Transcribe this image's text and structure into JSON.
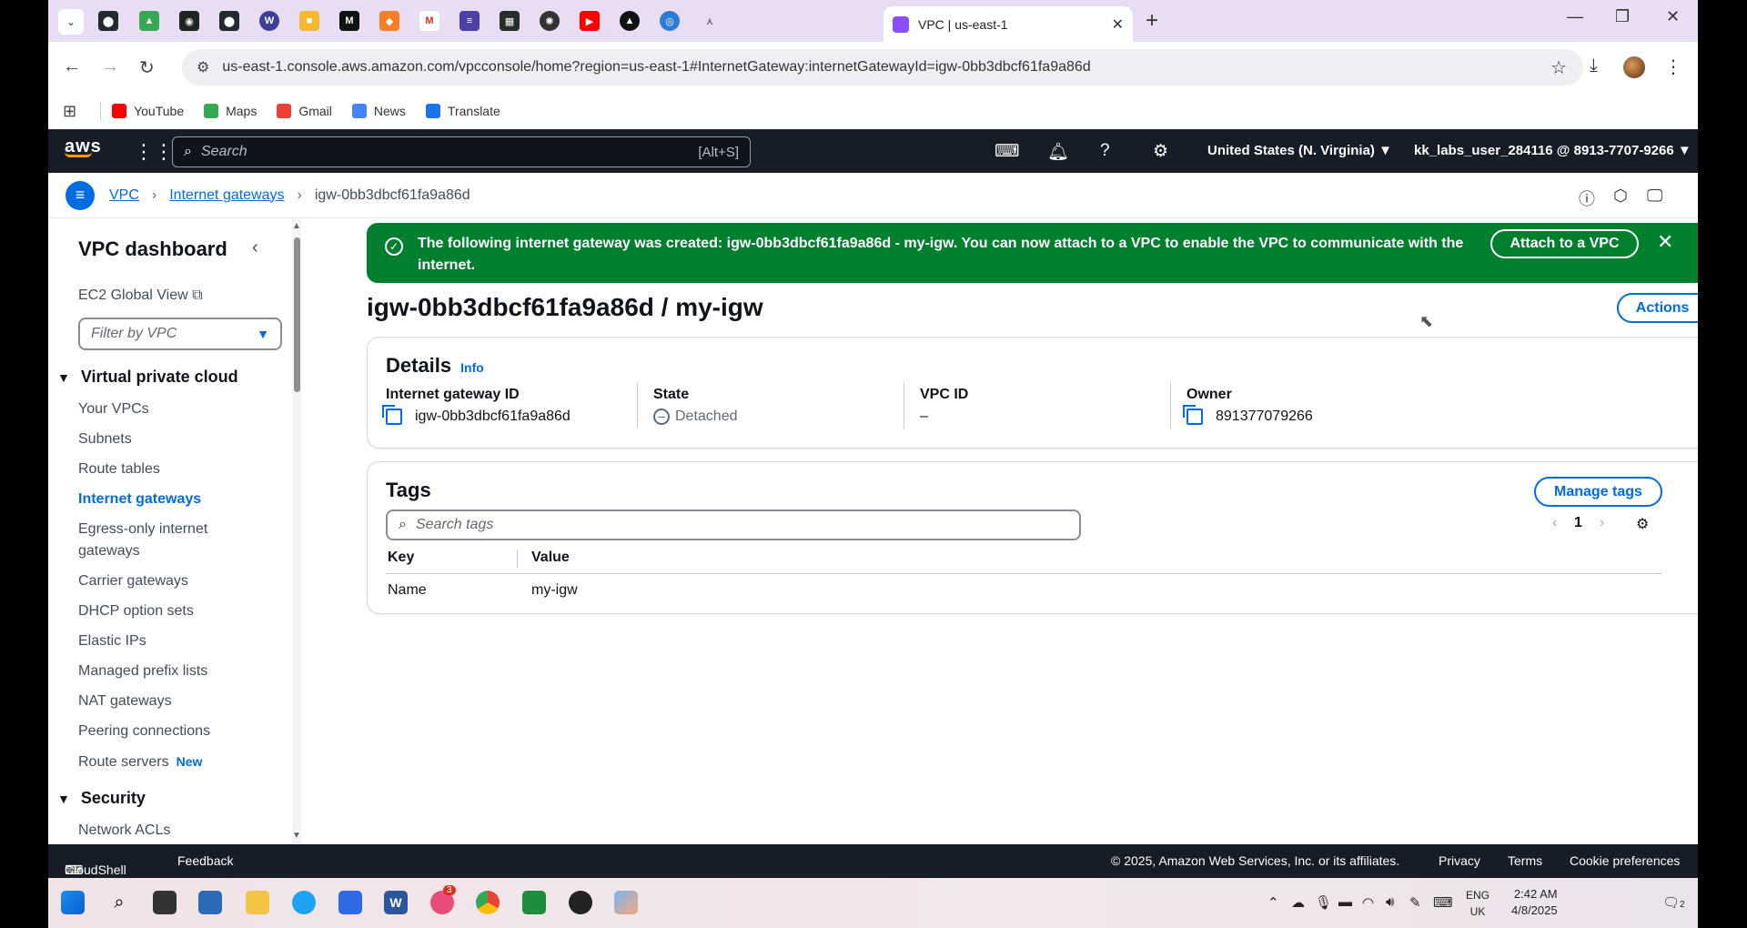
{
  "browser": {
    "active_tab_title": "VPC | us-east-1",
    "url": "us-east-1.console.aws.amazon.com/vpcconsole/home?region=us-east-1#InternetGateway:internetGatewayId=igw-0bb3dbcf61fa9a86d",
    "bookmarks": [
      "YouTube",
      "Maps",
      "Gmail",
      "News",
      "Translate"
    ]
  },
  "aws_nav": {
    "logo": "aws",
    "search_placeholder": "Search",
    "search_shortcut": "[Alt+S]",
    "region": "United States (N. Virginia) ▼",
    "account": "kk_labs_user_284116 @ 8913-7707-9266 ▼"
  },
  "breadcrumb": {
    "items": [
      "VPC",
      "Internet gateways"
    ],
    "current": "igw-0bb3dbcf61fa9a86d"
  },
  "sidebar": {
    "title": "VPC dashboard",
    "ec2_link": "EC2 Global View",
    "filter_placeholder": "Filter by VPC",
    "section_vpc": "Virtual private cloud",
    "items": [
      "Your VPCs",
      "Subnets",
      "Route tables",
      "Internet gateways",
      "Egress-only internet gateways",
      "Carrier gateways",
      "DHCP option sets",
      "Elastic IPs",
      "Managed prefix lists",
      "NAT gateways",
      "Peering connections",
      "Route servers"
    ],
    "new_badge": "New",
    "section_security": "Security",
    "security_items": [
      "Network ACLs"
    ]
  },
  "flash": {
    "message": "The following internet gateway was created: igw-0bb3dbcf61fa9a86d - my-igw. You can now attach to a VPC to enable the VPC to communicate with the internet.",
    "button": "Attach to a VPC"
  },
  "page": {
    "title": "igw-0bb3dbcf61fa9a86d / my-igw",
    "actions": "Actions"
  },
  "details": {
    "heading": "Details",
    "info": "Info",
    "fields": [
      {
        "label": "Internet gateway ID",
        "value": "igw-0bb3dbcf61fa9a86d"
      },
      {
        "label": "State",
        "value": "Detached"
      },
      {
        "label": "VPC ID",
        "value": "–"
      },
      {
        "label": "Owner",
        "value": "891377079266"
      }
    ]
  },
  "tags": {
    "heading": "Tags",
    "manage": "Manage tags",
    "search_placeholder": "Search tags",
    "page": "1",
    "columns": [
      "Key",
      "Value"
    ],
    "rows": [
      {
        "key": "Name",
        "value": "my-igw"
      }
    ]
  },
  "footer": {
    "cloudshell": "CloudShell",
    "feedback": "Feedback",
    "copyright": "© 2025, Amazon Web Services, Inc. or its affiliates.",
    "privacy": "Privacy",
    "terms": "Terms",
    "cookies": "Cookie preferences"
  },
  "taskbar": {
    "lang": "ENG",
    "locale": "UK",
    "time": "2:42 AM",
    "date": "4/8/2025",
    "chat_badge": "3",
    "notif_count": "2"
  },
  "colors": {
    "aws_nav": "#161d26",
    "link": "#006ce0",
    "success": "#00802f",
    "tab_strip": "#e9ddf4"
  }
}
